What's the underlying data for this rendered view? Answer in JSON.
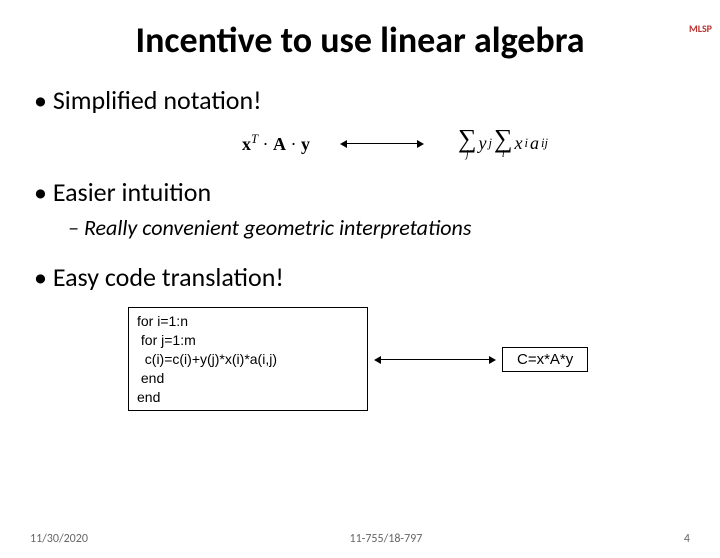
{
  "logo": "MLSP",
  "title": "Incentive to use linear algebra",
  "bullets": {
    "one": "Simplified notation!",
    "two": "Easier intuition",
    "two_sub": "Really convenient geometric interpretations",
    "three": "Easy code translation!"
  },
  "formula": {
    "lhs_x": "x",
    "lhs_T": "T",
    "dot": " · ",
    "lhs_A": "A",
    "lhs_y": "y",
    "sum_j": "j",
    "yj_y": "y",
    "yj_j": "j",
    "sum_i": "i",
    "xi_x": "x",
    "xi_i": "i",
    "aij_a": "a",
    "aij_ij": "ij"
  },
  "code": {
    "loop": "for i=1:n\n for j=1:m\n  c(i)=c(i)+y(j)*x(i)*a(i,j)\n end\nend",
    "vec": "C=x*A*y"
  },
  "footer": {
    "date": "11/30/2020",
    "course": "11-755/18-797",
    "page": "4"
  }
}
